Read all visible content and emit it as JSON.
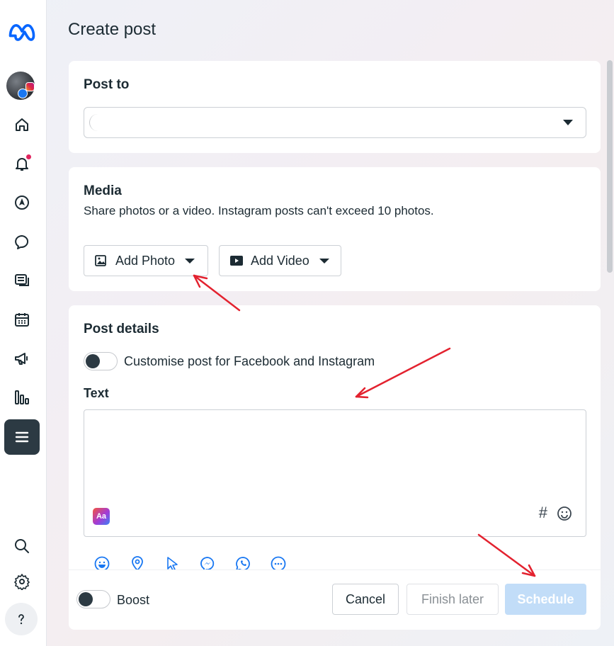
{
  "page": {
    "title": "Create post"
  },
  "post_to": {
    "title": "Post to",
    "select_value": ""
  },
  "media": {
    "title": "Media",
    "description": "Share photos or a video. Instagram posts can't exceed 10 photos.",
    "add_photo_label": "Add Photo",
    "add_video_label": "Add Video"
  },
  "post_details": {
    "title": "Post details",
    "customise_label": "Customise post for Facebook and Instagram",
    "text_label": "Text",
    "text_value": "",
    "aa_label": "Aa",
    "hash_label": "#"
  },
  "footer": {
    "boost_label": "Boost",
    "cancel_label": "Cancel",
    "finish_later_label": "Finish later",
    "schedule_label": "Schedule"
  },
  "sidebar": {
    "items": [
      "meta-logo",
      "profile-avatar",
      "home-icon",
      "notifications-icon",
      "compass-icon",
      "messages-icon",
      "content-icon",
      "calendar-icon",
      "ads-icon",
      "insights-icon",
      "menu-icon",
      "search-icon",
      "settings-icon",
      "help-icon"
    ]
  },
  "toolbar_icons": [
    "emoji-face-icon",
    "location-pin-icon",
    "cursor-icon",
    "messenger-icon",
    "whatsapp-icon",
    "more-icon"
  ],
  "colors": {
    "accent": "#1877f2",
    "schedule_disabled": "#c2ddf8",
    "annotation_arrow": "#e3222f",
    "sidebar_active": "#2c3a43"
  }
}
